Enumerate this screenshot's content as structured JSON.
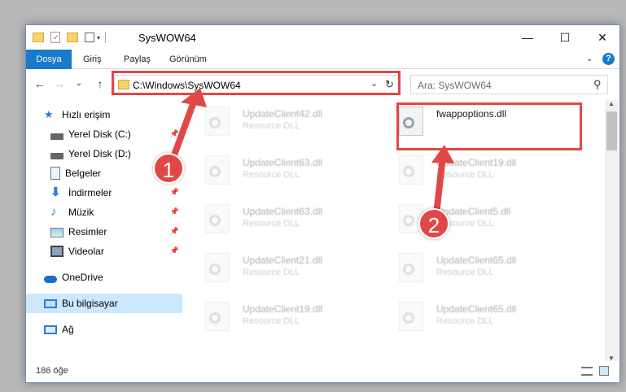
{
  "window": {
    "title": "SysWOW64",
    "controls": {
      "minimize": "—",
      "maximize": "☐",
      "close": "✕"
    }
  },
  "ribbon": {
    "tabs": [
      {
        "label": "Dosya"
      },
      {
        "label": "Giriş"
      },
      {
        "label": "Paylaş"
      },
      {
        "label": "Görünüm"
      }
    ],
    "help": "?"
  },
  "navigation": {
    "back": "←",
    "forward": "→",
    "recent": "⌄",
    "up": "↑",
    "address": "C:\\Windows\\SysWOW64",
    "address_dropdown": "⌄",
    "refresh": "↻",
    "search_placeholder": "Ara: SysWOW64",
    "search_icon": "⚲"
  },
  "sidebar": {
    "items": [
      {
        "label": "Hızlı erişim",
        "icon": "star-icon"
      },
      {
        "label": "Yerel Disk (C:)",
        "icon": "drive-icon",
        "pinned": true
      },
      {
        "label": "Yerel Disk (D:)",
        "icon": "drive-icon"
      },
      {
        "label": "Belgeler",
        "icon": "documents-icon",
        "pinned": true
      },
      {
        "label": "İndirmeler",
        "icon": "downloads-icon",
        "pinned": true
      },
      {
        "label": "Müzik",
        "icon": "music-icon",
        "pinned": true
      },
      {
        "label": "Resimler",
        "icon": "pictures-icon",
        "pinned": true
      },
      {
        "label": "Videolar",
        "icon": "videos-icon",
        "pinned": true
      },
      {
        "label": "OneDrive",
        "icon": "cloud-icon"
      },
      {
        "label": "Bu bilgisayar",
        "icon": "computer-icon",
        "selected": true
      },
      {
        "label": "Ağ",
        "icon": "network-icon"
      }
    ],
    "pin_glyph": "📌"
  },
  "files": [
    {
      "name": "UpdateClient42.dll",
      "type": "Resource DLL",
      "faded": true
    },
    {
      "name": "fwappoptions.dll",
      "type": "",
      "faded": false,
      "highlighted": true
    },
    {
      "name": "UpdateClient63.dll",
      "type": "Resource DLL",
      "faded": true
    },
    {
      "name": "UpdateClient19.dll",
      "type": "Resource DLL",
      "faded": true
    },
    {
      "name": "UpdateClient63.dll",
      "type": "Resource DLL",
      "faded": true
    },
    {
      "name": "UpdateClient5.dll",
      "type": "Resource DLL",
      "faded": true
    },
    {
      "name": "UpdateClient21.dll",
      "type": "Resource DLL",
      "faded": true
    },
    {
      "name": "UpdateClient65.dll",
      "type": "Resource DLL",
      "faded": true
    },
    {
      "name": "UpdateClient19.dll",
      "type": "Resource DLL",
      "faded": true
    },
    {
      "name": "UpdateClient65.dll",
      "type": "Resource DLL",
      "faded": true
    }
  ],
  "status": {
    "item_count": "186 öğe"
  },
  "annotations": {
    "step1": "1",
    "step2": "2",
    "color": "#e04848"
  }
}
